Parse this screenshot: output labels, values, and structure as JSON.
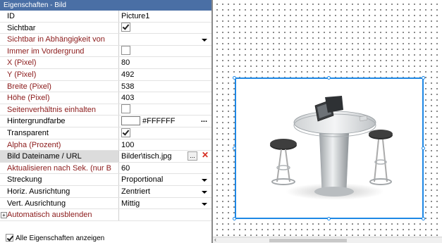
{
  "panel": {
    "title": "Eigenschaften - Bild",
    "rows": [
      {
        "name": "ID",
        "value": "Picture1"
      },
      {
        "name": "Sichtbar",
        "checked": true
      },
      {
        "name": "Sichtbar in Abhängigkeit von",
        "value": ""
      },
      {
        "name": "Immer im Vordergrund",
        "checked": false
      },
      {
        "name": "X (Pixel)",
        "value": "80"
      },
      {
        "name": "Y (Pixel)",
        "value": "492"
      },
      {
        "name": "Breite (Pixel)",
        "value": "538"
      },
      {
        "name": "Höhe (Pixel)",
        "value": "403"
      },
      {
        "name": "Seitenverhältnis einhalten",
        "checked": false
      },
      {
        "name": "Hintergrundfarbe",
        "value": "#FFFFFF",
        "button": "..."
      },
      {
        "name": "Transparent",
        "checked": true
      },
      {
        "name": "Alpha (Prozent)",
        "value": "100"
      },
      {
        "name": "Bild Dateiname / URL",
        "value": "Bilder\\tisch.jpg",
        "button": "...",
        "clear": "✕"
      },
      {
        "name": "Aktualisieren nach Sek. (nur B",
        "value": "60"
      },
      {
        "name": "Streckung",
        "value": "Proportional"
      },
      {
        "name": "Horiz. Ausrichtung",
        "value": "Zentriert"
      },
      {
        "name": "Vert. Ausrichtung",
        "value": "Mittig"
      },
      {
        "name": "Automatisch ausblenden",
        "value": ""
      }
    ],
    "footer_label": "Alle Eigenschaften anzeigen",
    "footer_checked": true
  },
  "colors": {
    "selection": "#1e88e5",
    "title_bar": "#4a6fa5",
    "property_red": "#8b1a1a"
  },
  "icons": [
    "checkbox-icon",
    "dropdown-arrow-icon",
    "ellipsis-icon",
    "delete-x-icon",
    "expand-plus-icon",
    "table-with-stools-image"
  ]
}
